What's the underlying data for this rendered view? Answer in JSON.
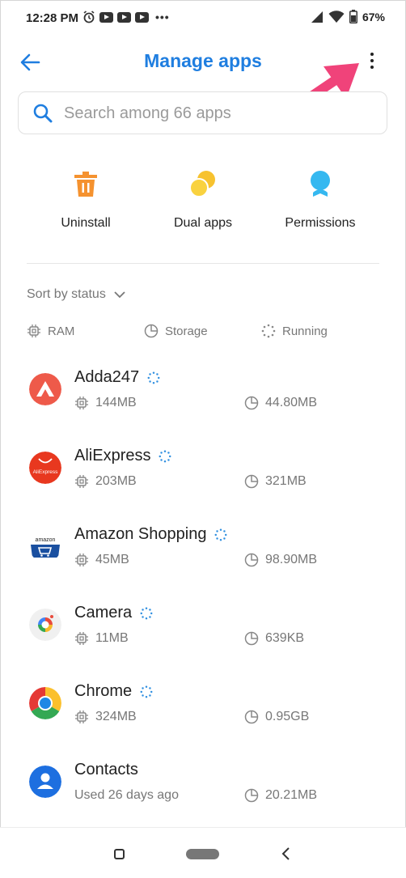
{
  "status_bar": {
    "time": "12:28 PM",
    "battery": "67%"
  },
  "header": {
    "title": "Manage apps"
  },
  "search": {
    "placeholder": "Search among 66 apps"
  },
  "actions": [
    {
      "label": "Uninstall",
      "icon": "trash-icon",
      "color": "#f5922f"
    },
    {
      "label": "Dual apps",
      "icon": "dual-apps-icon",
      "color": "#f7c22f"
    },
    {
      "label": "Permissions",
      "icon": "permissions-icon",
      "color": "#35b8f0"
    }
  ],
  "sort": {
    "label": "Sort by status"
  },
  "legend": {
    "ram": "RAM",
    "storage": "Storage",
    "running": "Running"
  },
  "apps": [
    {
      "name": "Adda247",
      "running": true,
      "ram": "144MB",
      "storage": "44.80MB"
    },
    {
      "name": "AliExpress",
      "running": true,
      "ram": "203MB",
      "storage": "321MB",
      "icon_text": "AliExpress"
    },
    {
      "name": "Amazon Shopping",
      "running": true,
      "ram": "45MB",
      "storage": "98.90MB",
      "icon_text": "amazon"
    },
    {
      "name": "Camera",
      "running": true,
      "ram": "11MB",
      "storage": "639KB"
    },
    {
      "name": "Chrome",
      "running": true,
      "ram": "324MB",
      "storage": "0.95GB"
    },
    {
      "name": "Contacts",
      "running": false,
      "ram": "Used 26 days ago",
      "storage": "20.21MB"
    }
  ],
  "colors": {
    "accent": "#1f7ee0",
    "arrow": "#f0437a"
  }
}
